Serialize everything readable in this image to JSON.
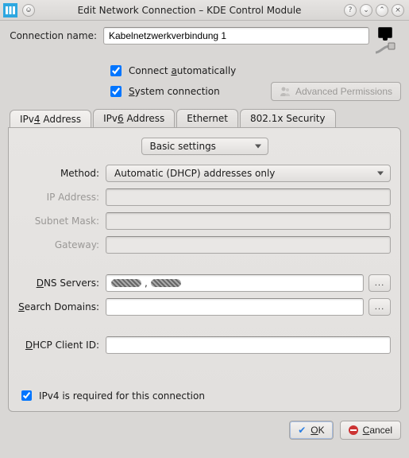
{
  "window": {
    "title": "Edit Network Connection – KDE Control Module"
  },
  "header": {
    "name_label": "Connection name:",
    "name_value": "Kabelnetzwerkverbindung 1",
    "connect_auto": "Connect automatically",
    "connect_auto_accel": "a",
    "system_connection": "System connection",
    "system_connection_accel": "S",
    "advanced_permissions": "Advanced Permissions"
  },
  "tabs": {
    "items": [
      {
        "label": "IPv4 Address",
        "accel": "4"
      },
      {
        "label": "IPv6 Address",
        "accel": "6"
      },
      {
        "label": "Ethernet",
        "accel": ""
      },
      {
        "label": "802.1x Security",
        "accel": ""
      }
    ],
    "active": 0
  },
  "ipv4": {
    "mode_select": "Basic settings",
    "method_label": "Method:",
    "method_value": "Automatic (DHCP) addresses only",
    "ip_label": "IP Address:",
    "subnet_label": "Subnet Mask:",
    "gateway_label": "Gateway:",
    "dns_label": "DNS Servers:",
    "dns_accel": "D",
    "dns_value": "",
    "search_label": "Search Domains:",
    "search_accel": "S",
    "search_value": "",
    "dhcp_client_label": "DHCP Client ID:",
    "dhcp_client_accel": "D",
    "dhcp_client_value": "",
    "required_label": "IPv4 is required for this connection",
    "dots": "..."
  },
  "buttons": {
    "ok": "OK",
    "ok_accel": "O",
    "cancel": "Cancel",
    "cancel_accel": "C"
  }
}
